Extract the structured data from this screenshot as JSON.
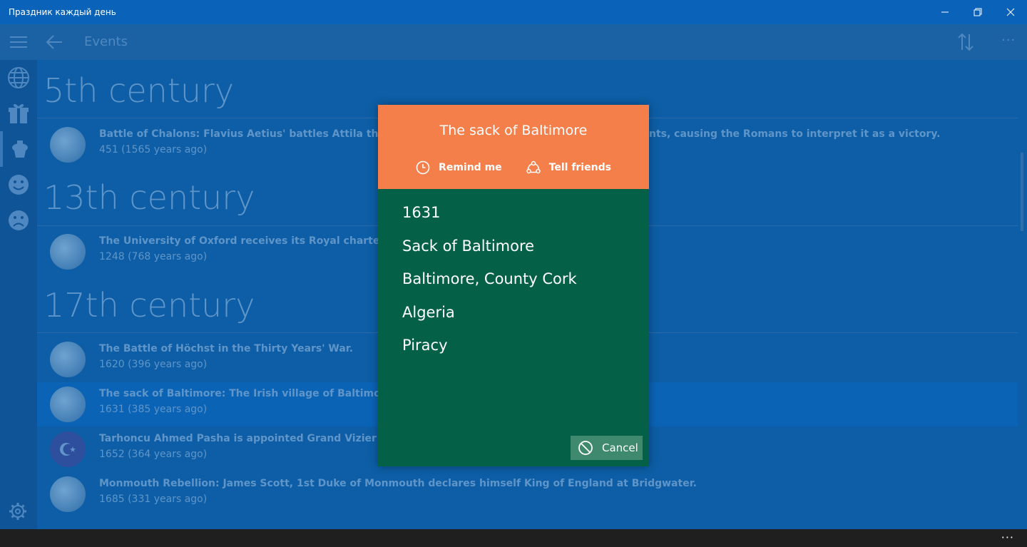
{
  "window": {
    "title": "Праздник каждый день"
  },
  "appbar": {
    "page_title": "Events",
    "more_label": "···"
  },
  "colors": {
    "accent_orange": "#f47f4b",
    "dialog_green": "#046147",
    "app_blue": "#0d5ea6"
  },
  "rail": {
    "items": [
      {
        "icon": "globe-icon"
      },
      {
        "icon": "gift-icon"
      },
      {
        "icon": "cake-icon"
      },
      {
        "icon": "happy-face-icon"
      },
      {
        "icon": "sad-face-icon"
      }
    ],
    "settings_icon": "gear-icon"
  },
  "list": {
    "centuries": [
      "5th century",
      "13th century",
      "17th century"
    ],
    "events": [
      {
        "text": "Battle of Chalons: Flavius Aetius' battles Attila the Hun",
        "text_tail": "nts, causing the Romans to interpret it as a victory.",
        "meta": "451  (1565 years ago)"
      },
      {
        "text": "The University of Oxford receives its Royal charter.",
        "meta": "1248  (768 years ago)"
      },
      {
        "text": "The Battle of Höchst in the Thirty Years' War.",
        "meta": "1620  (396 years ago)"
      },
      {
        "text": "The sack of Baltimore: The Irish village of Baltimore is a",
        "meta": "1631  (385 years ago)"
      },
      {
        "text": "Tarhoncu Ahmed Pasha is appointed Grand Vizier of th",
        "meta": "1652  (364 years ago)"
      },
      {
        "text": "Monmouth Rebellion: James Scott, 1st Duke of Monmouth declares himself King of England at Bridgwater.",
        "meta": "1685  (331 years ago)"
      }
    ]
  },
  "dialog": {
    "title": "The sack of Baltimore",
    "remind_label": "Remind me",
    "tell_label": "Tell friends",
    "lines": [
      "1631",
      "Sack of Baltimore",
      "Baltimore, County Cork",
      "Algeria",
      "Piracy"
    ],
    "cancel_label": "Cancel"
  },
  "taskbar": {
    "more_label": "···"
  }
}
